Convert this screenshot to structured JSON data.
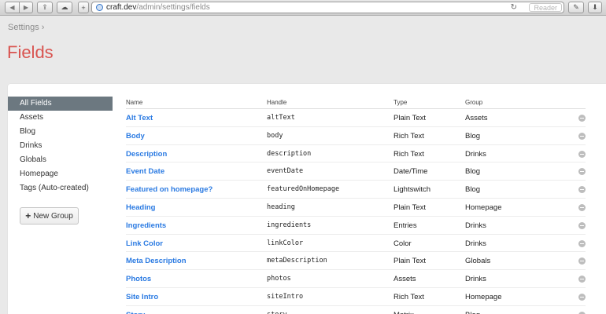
{
  "browser": {
    "url_host": "craft.dev",
    "url_path": "/admin/settings/fields",
    "reader_label": "Reader",
    "reload_glyph": "↻",
    "plus_glyph": "+"
  },
  "breadcrumb": "Settings ›",
  "page_title": "Fields",
  "sidebar": {
    "items": [
      {
        "label": "All Fields",
        "selected": true
      },
      {
        "label": "Assets"
      },
      {
        "label": "Blog"
      },
      {
        "label": "Drinks"
      },
      {
        "label": "Globals"
      },
      {
        "label": "Homepage"
      },
      {
        "label": "Tags (Auto-created)"
      }
    ],
    "new_group_label": "New Group",
    "new_group_icon": "+"
  },
  "table": {
    "headers": {
      "name": "Name",
      "handle": "Handle",
      "type": "Type",
      "group": "Group"
    },
    "rows": [
      {
        "name": "Alt Text",
        "handle": "altText",
        "type": "Plain Text",
        "group": "Assets"
      },
      {
        "name": "Body",
        "handle": "body",
        "type": "Rich Text",
        "group": "Blog"
      },
      {
        "name": "Description",
        "handle": "description",
        "type": "Rich Text",
        "group": "Drinks"
      },
      {
        "name": "Event Date",
        "handle": "eventDate",
        "type": "Date/Time",
        "group": "Blog"
      },
      {
        "name": "Featured on homepage?",
        "handle": "featuredOnHomepage",
        "type": "Lightswitch",
        "group": "Blog"
      },
      {
        "name": "Heading",
        "handle": "heading",
        "type": "Plain Text",
        "group": "Homepage"
      },
      {
        "name": "Ingredients",
        "handle": "ingredients",
        "type": "Entries",
        "group": "Drinks"
      },
      {
        "name": "Link Color",
        "handle": "linkColor",
        "type": "Color",
        "group": "Drinks"
      },
      {
        "name": "Meta Description",
        "handle": "metaDescription",
        "type": "Plain Text",
        "group": "Globals"
      },
      {
        "name": "Photos",
        "handle": "photos",
        "type": "Assets",
        "group": "Drinks"
      },
      {
        "name": "Site Intro",
        "handle": "siteIntro",
        "type": "Rich Text",
        "group": "Homepage"
      },
      {
        "name": "Story",
        "handle": "story",
        "type": "Matrix",
        "group": "Blog"
      }
    ]
  },
  "colors": {
    "accent_title": "#d9534f",
    "link": "#2a7ae2",
    "selected_bg": "#6c7880"
  }
}
